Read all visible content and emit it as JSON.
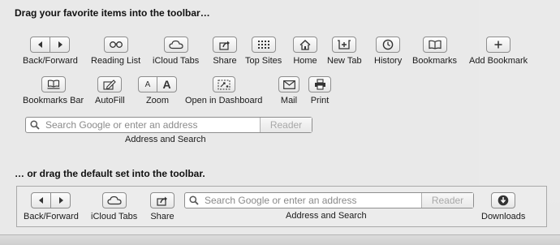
{
  "headings": {
    "favorites": "Drag your favorite items into the toolbar…",
    "default_set": "… or drag the default set into the toolbar."
  },
  "items": {
    "back_forward": "Back/Forward",
    "reading_list": "Reading List",
    "icloud_tabs": "iCloud Tabs",
    "share": "Share",
    "top_sites": "Top Sites",
    "home": "Home",
    "new_tab": "New Tab",
    "history": "History",
    "bookmarks": "Bookmarks",
    "add_bookmark": "Add Bookmark",
    "bookmarks_bar": "Bookmarks Bar",
    "autofill": "AutoFill",
    "zoom": "Zoom",
    "open_in_dashboard": "Open in Dashboard",
    "mail": "Mail",
    "print": "Print",
    "address_and_search": "Address and Search",
    "downloads": "Downloads"
  },
  "zoom_glyphs": {
    "small": "A",
    "large": "A"
  },
  "address": {
    "placeholder": "Search Google or enter an address",
    "reader": "Reader"
  },
  "default_set": {
    "back_forward": "Back/Forward",
    "icloud_tabs": "iCloud Tabs",
    "share": "Share",
    "address_and_search": "Address and Search",
    "downloads": "Downloads",
    "placeholder": "Search Google or enter an address",
    "reader": "Reader"
  },
  "icons": [
    "chevron-left-icon",
    "chevron-right-icon",
    "glasses-icon",
    "cloud-icon",
    "share-icon",
    "grid-icon",
    "house-icon",
    "new-tab-icon",
    "clock-icon",
    "book-icon",
    "plus-icon",
    "bookmarks-bar-icon",
    "pencil-icon",
    "dashboard-icon",
    "envelope-icon",
    "printer-icon",
    "search-icon",
    "download-icon"
  ]
}
